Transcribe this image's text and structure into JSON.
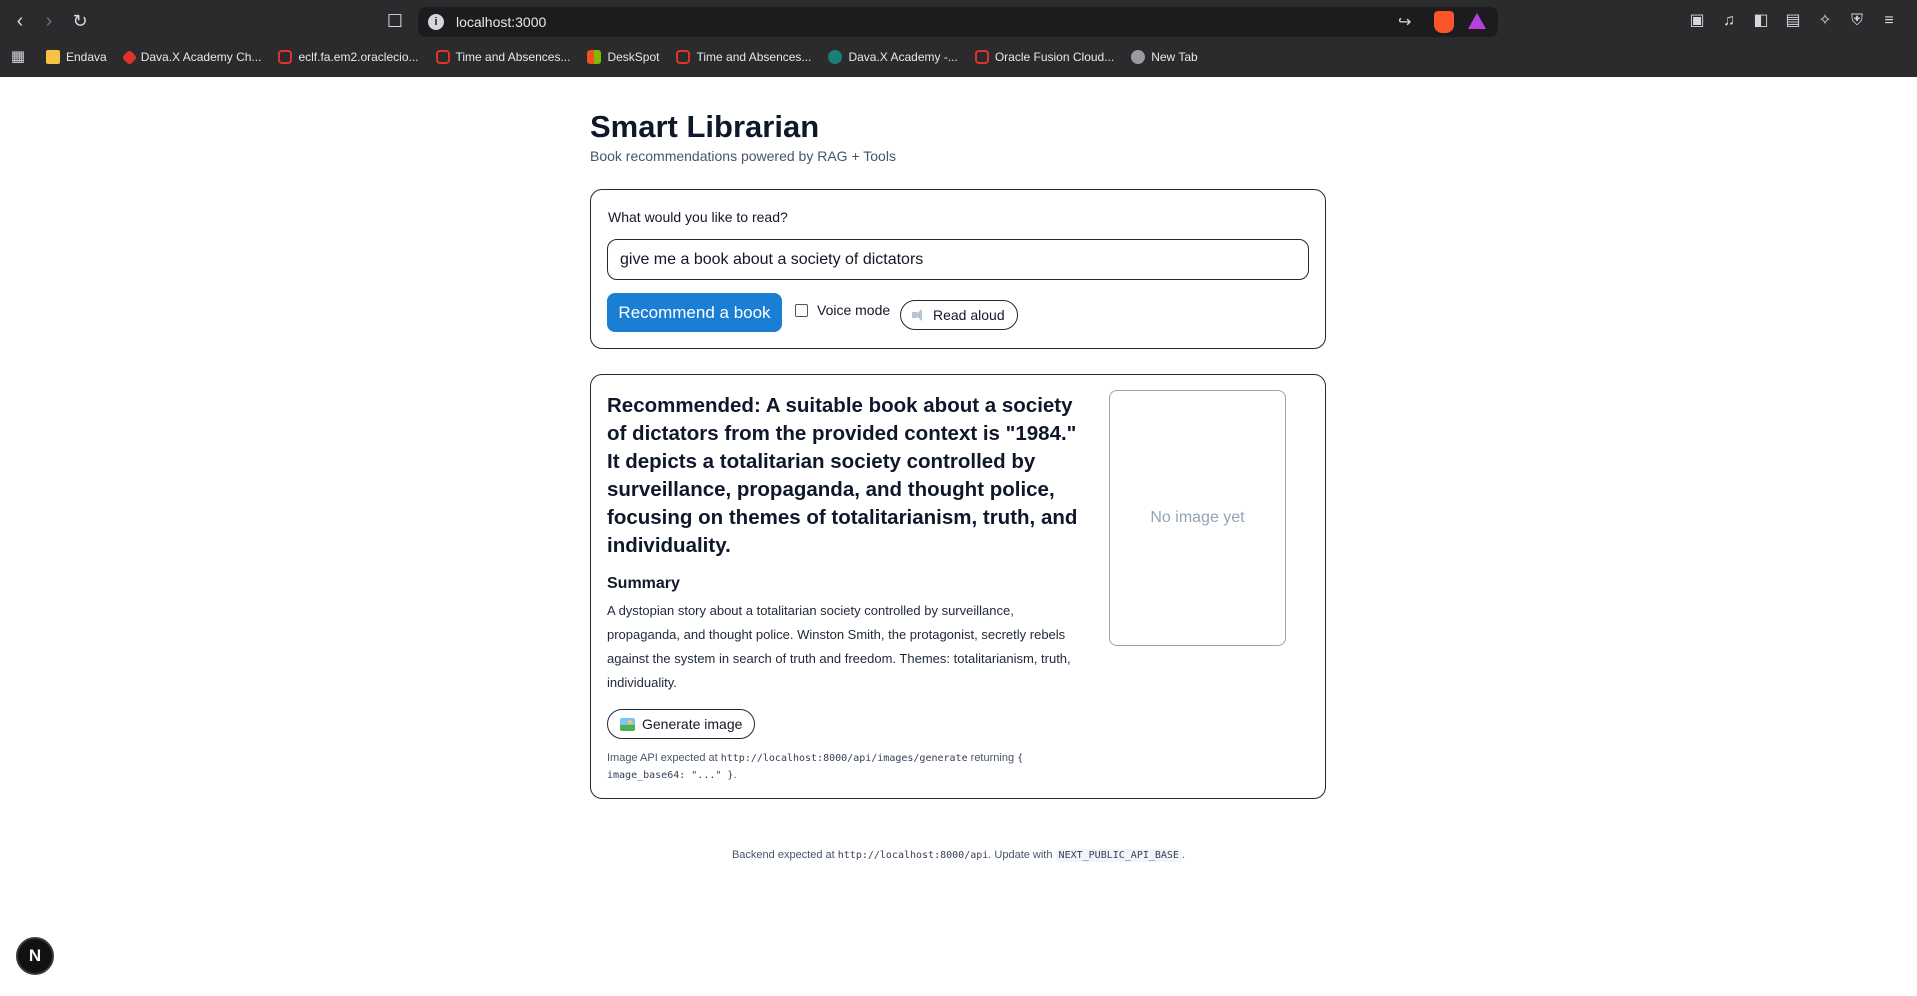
{
  "browser": {
    "url": "localhost:3000",
    "bookmarks": [
      {
        "label": "Endava",
        "icon": "folder-icon"
      },
      {
        "label": "Dava.X Academy Ch...",
        "icon": "dava-icon"
      },
      {
        "label": "eclf.fa.em2.oraclecio...",
        "icon": "oracle-icon"
      },
      {
        "label": "Time and Absences...",
        "icon": "oracle-icon"
      },
      {
        "label": "DeskSpot",
        "icon": "microsoft-icon"
      },
      {
        "label": "Time and Absences...",
        "icon": "oracle-icon"
      },
      {
        "label": "Dava.X Academy -...",
        "icon": "sharepoint-icon"
      },
      {
        "label": "Oracle Fusion Cloud...",
        "icon": "oracle-icon"
      },
      {
        "label": "New Tab",
        "icon": "globe-icon"
      }
    ]
  },
  "app": {
    "title": "Smart Librarian",
    "subtitle": "Book recommendations powered by RAG + Tools"
  },
  "query": {
    "label": "What would you like to read?",
    "value": "give me a book about a society of dictators",
    "recommend_label": "Recommend a book",
    "voice_mode_label": "Voice mode",
    "voice_mode_checked": false,
    "read_aloud_label": "Read aloud"
  },
  "result": {
    "heading": "Recommended: A suitable book about a society of dictators from the provided context is \"1984.\" It depicts a totalitarian society controlled by surveillance, propaganda, and thought police, focusing on themes of totalitarianism, truth, and individuality.",
    "summary_label": "Summary",
    "summary_text": "A dystopian story about a totalitarian society controlled by surveillance, propaganda, and thought police. Winston Smith, the protagonist, secretly rebels against the system in search of truth and freedom. Themes: totalitarianism, truth, individuality.",
    "generate_label": "Generate image",
    "api_note_prefix": "Image API expected at ",
    "api_note_url": "http://localhost:8000/api/images/generate",
    "api_note_mid": " returning ",
    "api_note_code": "{ image_base64: \"...\" }",
    "api_note_suffix": ".",
    "image_placeholder": "No image yet"
  },
  "footer": {
    "prefix": "Backend expected at ",
    "url": "http://localhost:8000/api",
    "mid": ". Update with ",
    "env": "NEXT_PUBLIC_API_BASE",
    "suffix": "."
  },
  "badge": "N"
}
